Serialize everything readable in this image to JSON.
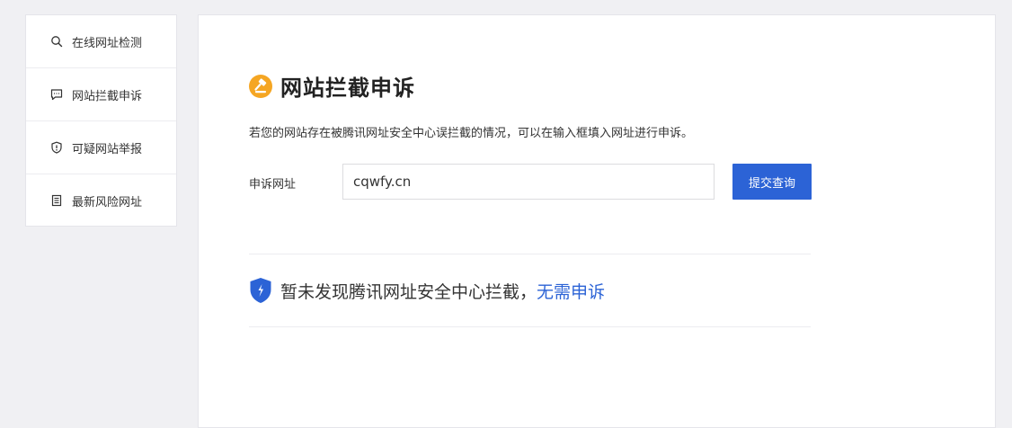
{
  "sidebar": {
    "items": [
      {
        "label": "在线网址检测",
        "icon": "search-icon"
      },
      {
        "label": "网站拦截申诉",
        "icon": "chat-icon"
      },
      {
        "label": "可疑网站举报",
        "icon": "shield-alert-icon"
      },
      {
        "label": "最新风险网址",
        "icon": "document-list-icon"
      }
    ]
  },
  "main": {
    "title": "网站拦截申诉",
    "title_icon": "gavel-icon",
    "description": "若您的网站存在被腾讯网址安全中心误拦截的情况，可以在输入框填入网址进行申诉。",
    "form": {
      "label": "申诉网址",
      "input_value": "cqwfy.cn",
      "submit_label": "提交查询"
    },
    "result": {
      "icon": "shield-icon",
      "text": "暂未发现腾讯网址安全中心拦截，",
      "link": "无需申诉"
    }
  },
  "colors": {
    "accent": "#2c63d6",
    "title_icon_bg": "#f5a623",
    "page_bg": "#f0f0f3"
  }
}
